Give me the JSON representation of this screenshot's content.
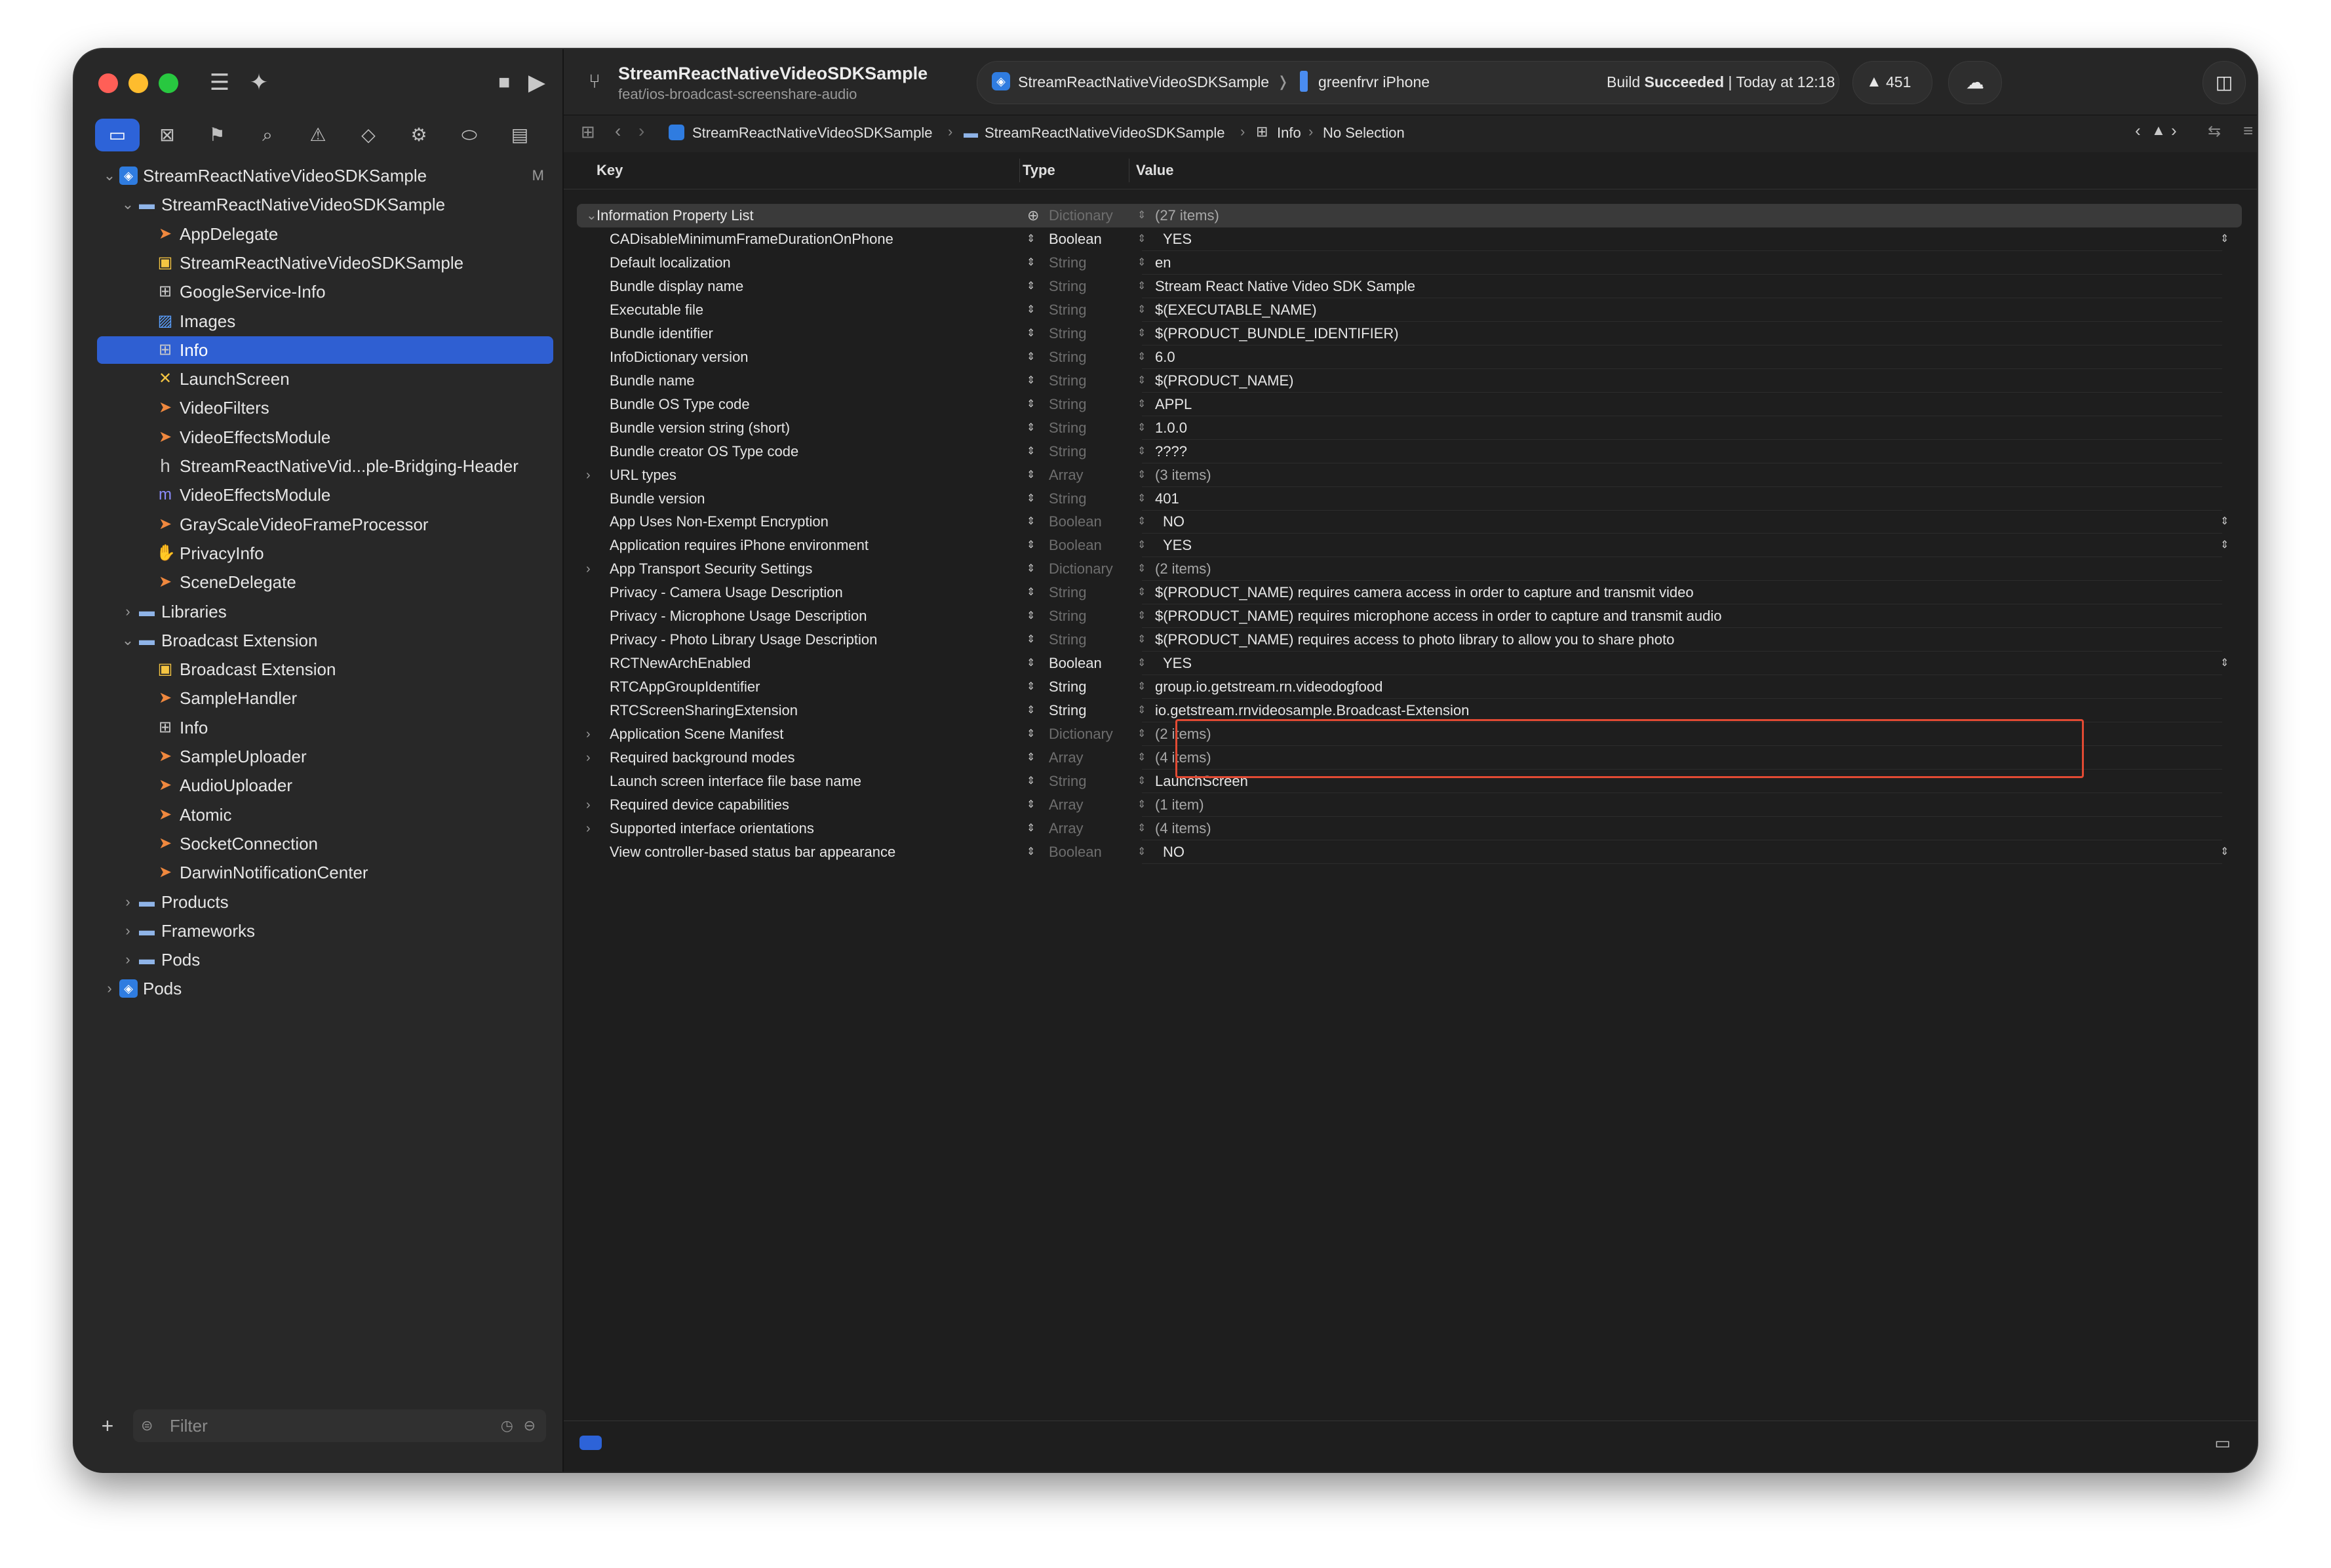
{
  "toolbar": {
    "project_name": "StreamReactNativeVideoSDKSample",
    "branch": "feat/ios-broadcast-screenshare-audio",
    "scheme": "StreamReactNativeVideoSDKSample",
    "scheme_separator": "❭",
    "device": "greenfrvr iPhone",
    "build_status_prefix": "Build ",
    "build_status_bold": "Succeeded",
    "build_status_time": " | Today at 12:18",
    "warnings_count": "451"
  },
  "navigator": {
    "tabs": [
      "project",
      "source-control",
      "bookmarks",
      "find",
      "issues",
      "tests",
      "debug",
      "breakpoints",
      "reports"
    ],
    "items": [
      {
        "label": "StreamReactNativeVideoSDKSample",
        "icon": "project-icon",
        "depth": 0,
        "disclosure": "open",
        "badge": "M"
      },
      {
        "label": "StreamReactNativeVideoSDKSample",
        "icon": "folder-icon",
        "depth": 1,
        "disclosure": "open"
      },
      {
        "label": "AppDelegate",
        "icon": "swift-file-icon",
        "depth": 2
      },
      {
        "label": "StreamReactNativeVideoSDKSample",
        "icon": "entitlements-icon",
        "depth": 2
      },
      {
        "label": "GoogleService-Info",
        "icon": "plist-icon",
        "depth": 2
      },
      {
        "label": "Images",
        "icon": "assets-icon",
        "depth": 2
      },
      {
        "label": "Info",
        "icon": "plist-icon",
        "depth": 2,
        "selected": true
      },
      {
        "label": "LaunchScreen",
        "icon": "storyboard-icon",
        "depth": 2
      },
      {
        "label": "VideoFilters",
        "icon": "swift-file-icon",
        "depth": 2
      },
      {
        "label": "VideoEffectsModule",
        "icon": "swift-file-icon",
        "depth": 2
      },
      {
        "label": "StreamReactNativeVid...ple-Bridging-Header",
        "icon": "header-file-icon",
        "depth": 2
      },
      {
        "label": "VideoEffectsModule",
        "icon": "objc-file-icon",
        "depth": 2
      },
      {
        "label": "GrayScaleVideoFrameProcessor",
        "icon": "swift-file-icon",
        "depth": 2
      },
      {
        "label": "PrivacyInfo",
        "icon": "privacy-icon",
        "depth": 2
      },
      {
        "label": "SceneDelegate",
        "icon": "swift-file-icon",
        "depth": 2
      },
      {
        "label": "Libraries",
        "icon": "folder-icon",
        "depth": 1,
        "disclosure": "closed"
      },
      {
        "label": "Broadcast Extension",
        "icon": "folder-icon",
        "depth": 1,
        "disclosure": "open"
      },
      {
        "label": "Broadcast Extension",
        "icon": "entitlements-icon",
        "depth": 2
      },
      {
        "label": "SampleHandler",
        "icon": "swift-file-icon",
        "depth": 2
      },
      {
        "label": "Info",
        "icon": "plist-icon",
        "depth": 2
      },
      {
        "label": "SampleUploader",
        "icon": "swift-file-icon",
        "depth": 2
      },
      {
        "label": "AudioUploader",
        "icon": "swift-file-icon",
        "depth": 2
      },
      {
        "label": "Atomic",
        "icon": "swift-file-icon",
        "depth": 2
      },
      {
        "label": "SocketConnection",
        "icon": "swift-file-icon",
        "depth": 2
      },
      {
        "label": "DarwinNotificationCenter",
        "icon": "swift-file-icon",
        "depth": 2
      },
      {
        "label": "Products",
        "icon": "folder-icon",
        "depth": 1,
        "disclosure": "closed"
      },
      {
        "label": "Frameworks",
        "icon": "folder-icon",
        "depth": 1,
        "disclosure": "closed"
      },
      {
        "label": "Pods",
        "icon": "folder-icon",
        "depth": 1,
        "disclosure": "closed"
      },
      {
        "label": "Pods",
        "icon": "project-icon",
        "depth": 0,
        "disclosure": "closed"
      }
    ],
    "filter_placeholder": "Filter"
  },
  "jumpbar": {
    "crumbs": [
      "StreamReactNativeVideoSDKSample",
      "StreamReactNativeVideoSDKSample",
      "Info",
      "No Selection"
    ]
  },
  "plist": {
    "headers": {
      "key": "Key",
      "type": "Type",
      "value": "Value"
    },
    "root": {
      "key": "Information Property List",
      "type": "Dictionary",
      "value": "(27 items)"
    },
    "rows": [
      {
        "key": "CADisableMinimumFrameDurationOnPhone",
        "type": "Boolean",
        "value": "YES",
        "editable_type": true,
        "popup": true
      },
      {
        "key": "Default localization",
        "type": "String",
        "value": "en"
      },
      {
        "key": "Bundle display name",
        "type": "String",
        "value": "Stream React Native Video SDK Sample"
      },
      {
        "key": "Executable file",
        "type": "String",
        "value": "$(EXECUTABLE_NAME)"
      },
      {
        "key": "Bundle identifier",
        "type": "String",
        "value": "$(PRODUCT_BUNDLE_IDENTIFIER)"
      },
      {
        "key": "InfoDictionary version",
        "type": "String",
        "value": "6.0"
      },
      {
        "key": "Bundle name",
        "type": "String",
        "value": "$(PRODUCT_NAME)"
      },
      {
        "key": "Bundle OS Type code",
        "type": "String",
        "value": "APPL"
      },
      {
        "key": "Bundle version string (short)",
        "type": "String",
        "value": "1.0.0"
      },
      {
        "key": "Bundle creator OS Type code",
        "type": "String",
        "value": "????"
      },
      {
        "key": "URL types",
        "type": "Array",
        "value": "(3 items)",
        "collapsible": true
      },
      {
        "key": "Bundle version",
        "type": "String",
        "value": "401"
      },
      {
        "key": "App Uses Non-Exempt Encryption",
        "type": "Boolean",
        "value": "NO",
        "popup": true
      },
      {
        "key": "Application requires iPhone environment",
        "type": "Boolean",
        "value": "YES",
        "popup": true
      },
      {
        "key": "App Transport Security Settings",
        "type": "Dictionary",
        "value": "(2 items)",
        "collapsible": true
      },
      {
        "key": "Privacy - Camera Usage Description",
        "type": "String",
        "value": "$(PRODUCT_NAME) requires camera access in order to capture and transmit video"
      },
      {
        "key": "Privacy - Microphone Usage Description",
        "type": "String",
        "value": "$(PRODUCT_NAME) requires microphone access in order to capture and transmit audio"
      },
      {
        "key": "Privacy - Photo Library Usage Description",
        "type": "String",
        "value": "$(PRODUCT_NAME) requires access to photo library to allow you to share photo"
      },
      {
        "key": "RCTNewArchEnabled",
        "type": "Boolean",
        "value": "YES",
        "editable_type": true,
        "popup": true
      },
      {
        "key": "RTCAppGroupIdentifier",
        "type": "String",
        "value": "group.io.getstream.rn.videodogfood",
        "editable_type": true
      },
      {
        "key": "RTCScreenSharingExtension",
        "type": "String",
        "value": "io.getstream.rnvideosample.Broadcast-Extension",
        "editable_type": true
      },
      {
        "key": "Application Scene Manifest",
        "type": "Dictionary",
        "value": "(2 items)",
        "collapsible": true
      },
      {
        "key": "Required background modes",
        "type": "Array",
        "value": "(4 items)",
        "collapsible": true
      },
      {
        "key": "Launch screen interface file base name",
        "type": "String",
        "value": "LaunchScreen"
      },
      {
        "key": "Required device capabilities",
        "type": "Array",
        "value": "(1 item)",
        "collapsible": true
      },
      {
        "key": "Supported interface orientations",
        "type": "Array",
        "value": "(4 items)",
        "collapsible": true
      },
      {
        "key": "View controller-based status bar appearance",
        "type": "Boolean",
        "value": "NO",
        "popup": true
      }
    ]
  },
  "colors": {
    "accent": "#2d63d8",
    "highlight_box": "#e24a33",
    "close": "#ff5f57",
    "minimize": "#febc2e",
    "maximize": "#28c840"
  }
}
